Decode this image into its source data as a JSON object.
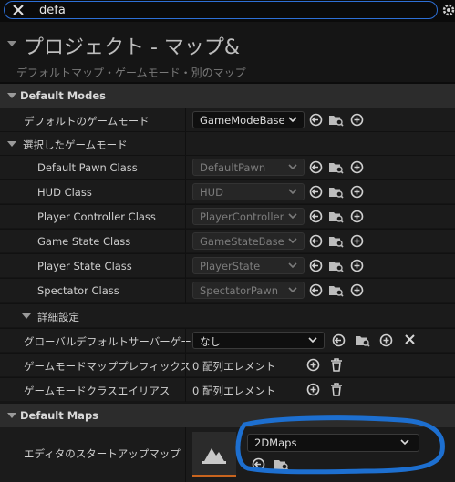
{
  "search": {
    "value": "defa"
  },
  "header": {
    "title": "プロジェクト - マップ&",
    "subtitle": "デフォルトマップ・ゲームモード・別のマップ"
  },
  "sections": {
    "default_modes": "Default Modes",
    "selected_game_mode": "選択したゲームモード",
    "advanced": "詳細設定",
    "default_maps": "Default Maps"
  },
  "default_game_mode": {
    "label": "デフォルトのゲームモード",
    "value": "GameModeBase"
  },
  "class_rows": [
    {
      "label": "Default Pawn Class",
      "value": "DefaultPawn"
    },
    {
      "label": "HUD Class",
      "value": "HUD"
    },
    {
      "label": "Player Controller Class",
      "value": "PlayerController"
    },
    {
      "label": "Game State Class",
      "value": "GameStateBase"
    },
    {
      "label": "Player State Class",
      "value": "PlayerState"
    },
    {
      "label": "Spectator Class",
      "value": "SpectatorPawn"
    }
  ],
  "global_server": {
    "label": "グローバルデフォルトサーバーゲー...",
    "value": "なし"
  },
  "prefix_row": {
    "label": "ゲームモードマッププレフィックス",
    "value": "0 配列エレメント"
  },
  "alias_row": {
    "label": "ゲームモードクラスエイリアス",
    "value": "0 配列エレメント"
  },
  "startup_map": {
    "label": "エディタのスタートアップマップ",
    "value": "2DMaps"
  },
  "colors": {
    "accent": "#2d6fd6",
    "annotation": "#1d6fd0",
    "panel": "#1b1b1b",
    "section": "#2c2c2c"
  }
}
